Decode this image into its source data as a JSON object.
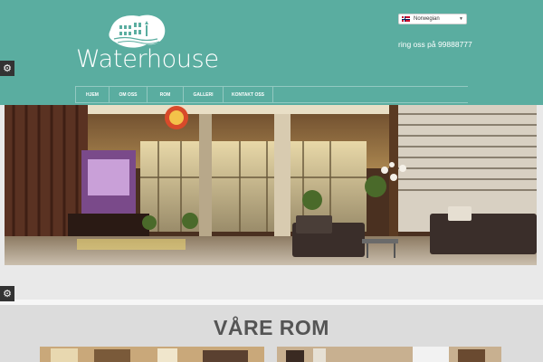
{
  "brand": {
    "name": "Waterhouse"
  },
  "language": {
    "selected": "Norwegian"
  },
  "contact": {
    "phone_text": "ring oss på 99888777"
  },
  "nav": {
    "items": [
      "HJEM",
      "OM OSS",
      "ROM",
      "GALLERI",
      "KONTAKT OSS"
    ]
  },
  "rooms": {
    "title": "VÅRE ROM"
  },
  "colors": {
    "header": "#5aada0",
    "background": "#e9e9e9",
    "title": "#555555",
    "gear": "#333333"
  },
  "icons": {
    "settings": "gear-icon",
    "language_flag": "norway-flag-icon",
    "dropdown": "chevron-down-icon",
    "logo": "building-logo-icon"
  }
}
